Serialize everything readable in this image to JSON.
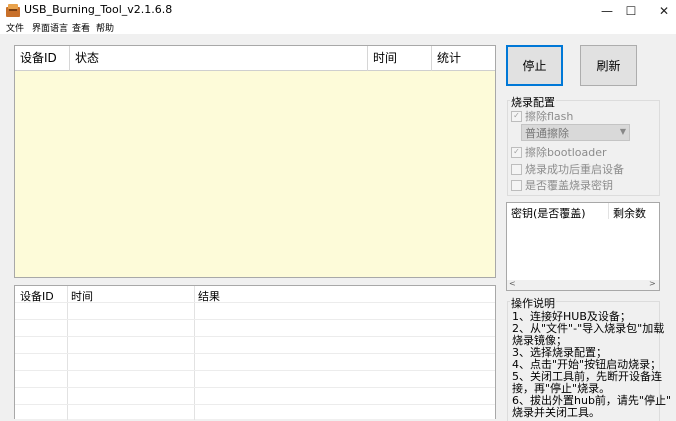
{
  "window": {
    "title": "USB_Burning_Tool_v2.1.6.8",
    "minimize_glyph": "—",
    "maximize_glyph": "☐",
    "close_glyph": "✕"
  },
  "menu": [
    "文件",
    "界面语言",
    "查看",
    "帮助"
  ],
  "top_table": {
    "columns": [
      "设备ID",
      "状态",
      "时间",
      "统计"
    ],
    "rows": []
  },
  "bottom_table": {
    "columns": [
      "设备ID",
      "时间",
      "结果"
    ],
    "rows": []
  },
  "buttons": {
    "stop": "停止",
    "refresh": "刷新"
  },
  "burn_config": {
    "title": "烧录配置",
    "erase_flash": {
      "label": "擦除flash",
      "checked": true,
      "enabled": false
    },
    "erase_mode": "普通擦除",
    "erase_bootloader": {
      "label": "擦除bootloader",
      "checked": true,
      "enabled": false
    },
    "reboot_after_success": {
      "label": "烧录成功后重启设备",
      "checked": false,
      "enabled": false
    },
    "overwrite_key": {
      "label": "是否覆盖烧录密钥",
      "checked": false,
      "enabled": false
    }
  },
  "key_list": {
    "columns": [
      "密钥(是否覆盖)",
      "剩余数"
    ],
    "scroll_left": "<",
    "scroll_right": ">"
  },
  "instructions": {
    "title": "操作说明",
    "lines": [
      "1、连接好HUB及设备；",
      "2、从\"文件\"-\"导入烧录包\"加载",
      "烧录镜像；",
      "3、选择烧录配置；",
      "4、点击\"开始\"按钮启动烧录；",
      "5、关闭工具前，先断开设备连",
      "接，再\"停止\"烧录。",
      "6、拔出外置hub前，请先\"停止\"",
      "烧录并关闭工具。"
    ]
  },
  "colors": {
    "accent": "#0078d7",
    "table_bg": "#fdfbd9",
    "window_bg": "#f0f0f0"
  }
}
